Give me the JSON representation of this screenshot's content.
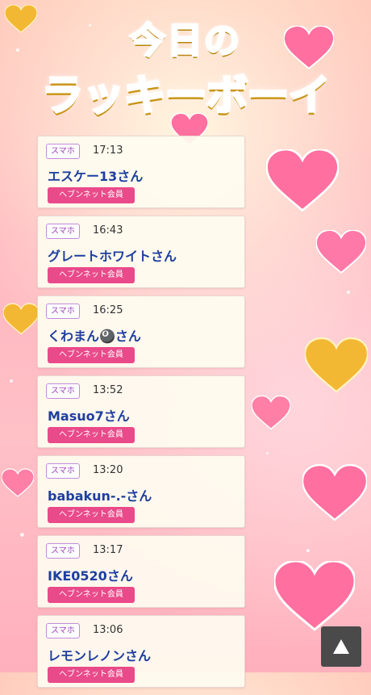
{
  "header": {
    "title_line1": "今日の",
    "title_line2": "ラッキーボーイ"
  },
  "colors": {
    "badge_border": "#c48ad9",
    "name_text": "#1e3fa0",
    "member_button": "#e94a8a",
    "heart_pink": "#ff6f9f",
    "heart_gold": "#f3b833"
  },
  "entries": [
    {
      "device": "スマホ",
      "time": "17:13",
      "name": "エスケー13さん",
      "member": "ヘブンネット会員"
    },
    {
      "device": "スマホ",
      "time": "16:43",
      "name": "グレートホワイトさん",
      "member": "ヘブンネット会員"
    },
    {
      "device": "スマホ",
      "time": "16:25",
      "name": "くわまん🎱さん",
      "member": "ヘブンネット会員"
    },
    {
      "device": "スマホ",
      "time": "13:52",
      "name": "Masuo7さん",
      "member": "ヘブンネット会員"
    },
    {
      "device": "スマホ",
      "time": "13:20",
      "name": "babakun-.-さん",
      "member": "ヘブンネット会員"
    },
    {
      "device": "スマホ",
      "time": "13:17",
      "name": "IKE0520さん",
      "member": "ヘブンネット会員"
    },
    {
      "device": "スマホ",
      "time": "13:06",
      "name": "レモンレノンさん",
      "member": "ヘブンネット会員"
    }
  ],
  "scroll_top": {
    "icon": "up-triangle-icon"
  }
}
